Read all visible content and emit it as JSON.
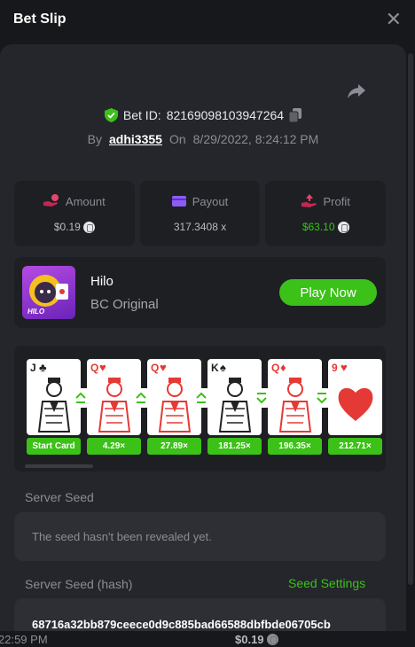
{
  "header": {
    "title": "Bet Slip",
    "close_symbol": "✕"
  },
  "bet": {
    "id_label": "Bet ID:",
    "id": "82169098103947264",
    "by_label": "By",
    "user": "adhi3355",
    "on_label": "On",
    "datetime": "8/29/2022, 8:24:12 PM"
  },
  "stats": {
    "amount_label": "Amount",
    "amount": "$0.19",
    "payout_label": "Payout",
    "payout": "317.3408 x",
    "profit_label": "Profit",
    "profit": "$63.10"
  },
  "game": {
    "name": "Hilo",
    "provider": "BC Original",
    "play_label": "Play Now",
    "thumb_text": "HILO"
  },
  "cards": [
    {
      "rank": "J",
      "suit": "♣",
      "color": "#222222",
      "multiplier": "Start Card",
      "arrow": "up"
    },
    {
      "rank": "Q",
      "suit": "♥",
      "color": "#e53935",
      "multiplier": "4.29×",
      "arrow": "up"
    },
    {
      "rank": "Q",
      "suit": "♥",
      "color": "#e53935",
      "multiplier": "27.89×",
      "arrow": "up"
    },
    {
      "rank": "K",
      "suit": "♠",
      "color": "#222222",
      "multiplier": "181.25×",
      "arrow": "down"
    },
    {
      "rank": "Q",
      "suit": "♦",
      "color": "#e53935",
      "multiplier": "196.35×",
      "arrow": "down"
    },
    {
      "rank": "9",
      "suit": "♥",
      "color": "#e53935",
      "multiplier": "212.71×",
      "arrow": ""
    }
  ],
  "seed": {
    "server_seed_label": "Server Seed",
    "server_seed_value": "The seed hasn't been revealed yet.",
    "hash_label": "Server Seed (hash)",
    "settings_label": "Seed Settings",
    "hash_value": "68716a32bb879ceece0d9c885bad66588dbfbde06705cb"
  },
  "background": {
    "time": "22:59 PM",
    "amount": "$0.19"
  },
  "colors": {
    "accent": "#3bc117",
    "panel": "#24262b",
    "background": "#17181b"
  }
}
